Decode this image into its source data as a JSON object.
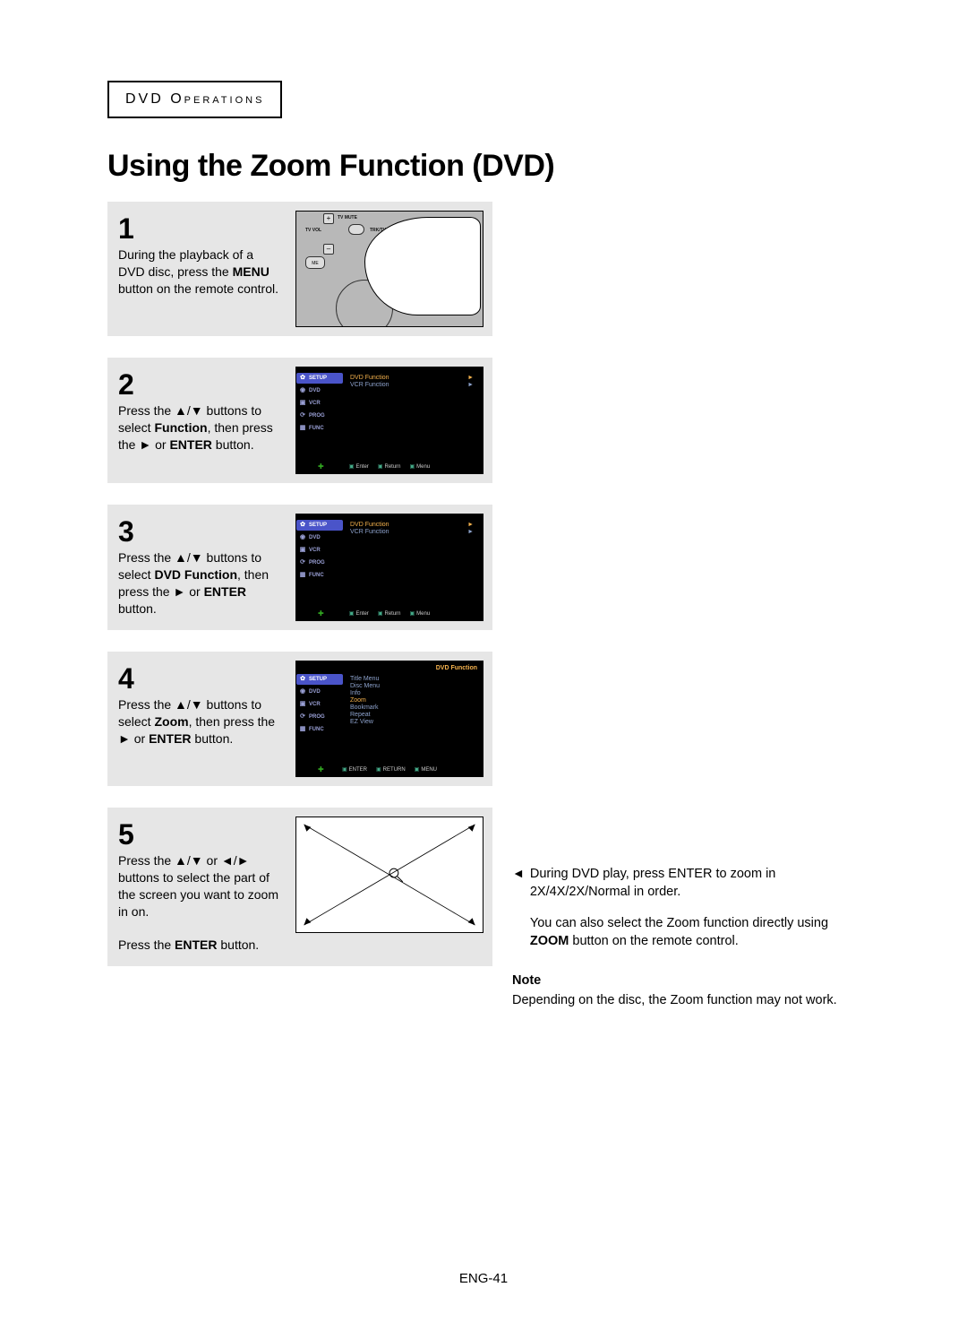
{
  "section_label": "DVD Operations",
  "page_title": "Using the Zoom Function (DVD)",
  "steps": {
    "s1": {
      "num": "1",
      "pre": "During the playback of a DVD disc, press the ",
      "bold": "MENU",
      "post": " button on the remote control.",
      "remote": {
        "tv_mute": "TV MUTE",
        "tv_vol": "TV VOL",
        "trk": "TRK/TV",
        "menu_small": "ME"
      }
    },
    "s2": {
      "num": "2",
      "pre": "Press the ",
      "arrows": "▲/▼",
      "mid": " buttons to select ",
      "bold": "Function",
      "post": ", then press the ",
      "arrow2": "►",
      "post2": " or ",
      "bold2": "ENTER",
      "post3": " button."
    },
    "s3": {
      "num": "3",
      "pre": "Press the ",
      "arrows": "▲/▼",
      "mid": " buttons to select ",
      "bold": "DVD Function",
      "post": ", then press the ",
      "arrow2": "►",
      "post2": " or ",
      "bold2": "ENTER",
      "post3": " button."
    },
    "s4": {
      "num": "4",
      "pre": "Press the ",
      "arrows": "▲/▼",
      "mid": " buttons to select ",
      "bold": "Zoom",
      "post": ", then press the ",
      "arrow2": "►",
      "post2": " or ",
      "bold2": "ENTER",
      "post3": " button."
    },
    "s5": {
      "num": "5",
      "pre": "Press the ",
      "arrows": "▲/▼",
      "mid": " or ",
      "arrows2": "◄/►",
      "post": " buttons to select the part of the screen you want to zoom in on.",
      "line2a": "Press the ",
      "line2b": "ENTER",
      "line2c": " button."
    }
  },
  "osd": {
    "sidebar": [
      "SETUP",
      "DVD",
      "VCR",
      "PROG",
      "FUNC"
    ],
    "sidebar_icons": [
      "✿",
      "◉",
      "▣",
      "⟳",
      "▦"
    ],
    "screen23": {
      "rows": [
        "DVD Function",
        "VCR Function"
      ]
    },
    "screen4": {
      "title": "DVD Function",
      "rows": [
        "Title Menu",
        "Disc Menu",
        "Info",
        "Zoom",
        "Bookmark",
        "Repeat",
        "EZ View"
      ]
    },
    "footer23": [
      "Enter",
      "Return",
      "Menu"
    ],
    "footer4": [
      "ENTER",
      "RETURN",
      "MENU"
    ]
  },
  "notes": {
    "lead_arrow": "◄",
    "lead": "During DVD play, press ENTER to zoom in 2X/4X/2X/Normal in order.",
    "para2a": "You can also select the Zoom function directly using ",
    "para2b": "ZOOM",
    "para2c": " button on the remote control.",
    "note_label": "Note",
    "note_text": "Depending on the disc, the Zoom function may not work."
  },
  "page_number": "ENG-41"
}
